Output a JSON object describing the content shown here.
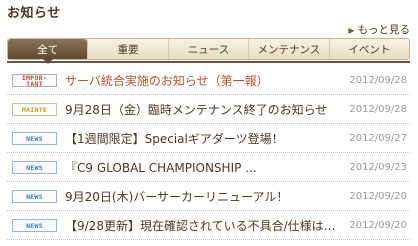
{
  "header": {
    "title": "お知らせ",
    "more_link": "もっと見る",
    "more_icon": "triangle-right-icon"
  },
  "tabs": [
    {
      "label": "全て",
      "active": true
    },
    {
      "label": "重要",
      "active": false
    },
    {
      "label": "ニュース",
      "active": false
    },
    {
      "label": "メンテナンス",
      "active": false
    },
    {
      "label": "イベント",
      "active": false
    }
  ],
  "news": [
    {
      "badge": "IMPOR-TANT",
      "badge_top": "IMPOR-",
      "badge_bottom": "TANT",
      "badge_type": "important",
      "headline": "サーバ統合実施のお知らせ（第一報）",
      "date": "2012/09/28"
    },
    {
      "badge": "MAINTE",
      "badge_type": "mainte",
      "headline": "9月28日（金）臨時メンテナンス終了のお知らせ",
      "date": "2012/09/28"
    },
    {
      "badge": "NEWS",
      "badge_type": "news",
      "headline": "【1週間限定】Specialギアダーツ登場！",
      "date": "2012/09/27"
    },
    {
      "badge": "NEWS",
      "badge_type": "news",
      "headline": "『C9 GLOBAL CHAMPIONSHIP ...",
      "date": "2012/09/23"
    },
    {
      "badge": "NEWS",
      "badge_type": "news",
      "headline": "9月20日(木)バーサーカーリニューアル！",
      "date": "2012/09/20"
    },
    {
      "badge": "NEWS",
      "badge_type": "news",
      "headline": "【9/28更新】現在確認されている不具合/仕様はこ...",
      "date": "2012/09/20"
    }
  ],
  "colors": {
    "accent": "#5e4a32",
    "important_badge": "#c8452a",
    "mainte_badge": "#d09a20",
    "news_badge": "#3a7ab8",
    "date_text": "#9a9a9a"
  }
}
